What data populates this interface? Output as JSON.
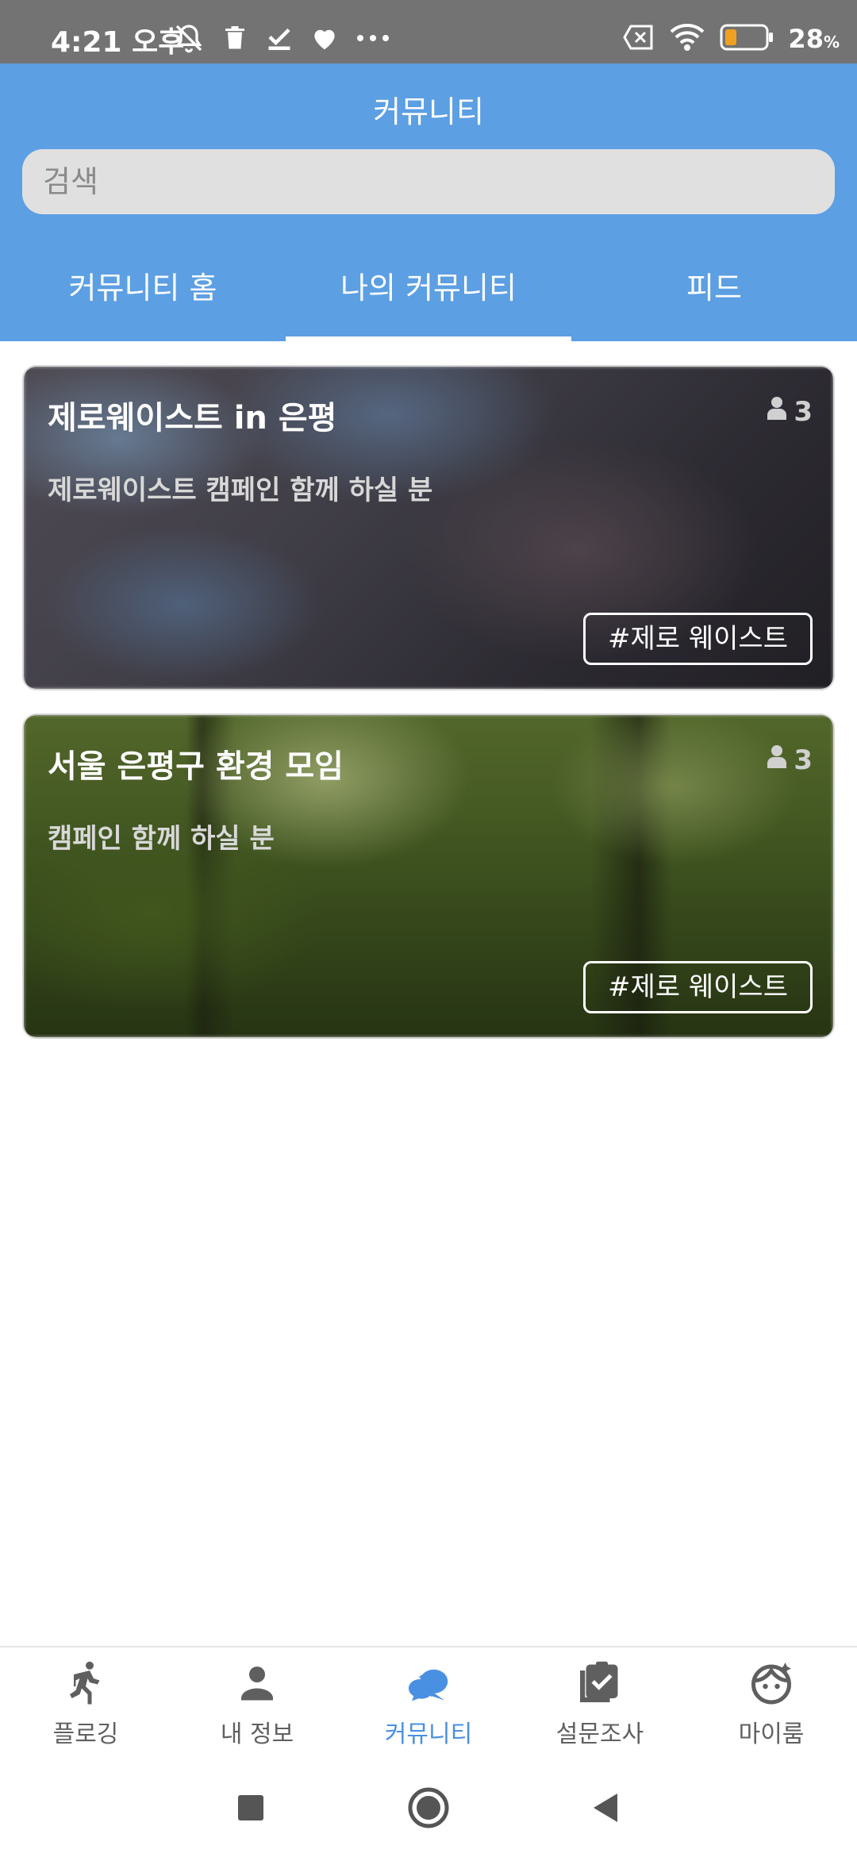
{
  "status_bar": {
    "time": "4:21 오후",
    "battery_percent": "28",
    "battery_unit": "%",
    "left_icons": [
      "silent-bell-off-icon",
      "trash-icon",
      "check-download-icon",
      "heart-icon",
      "more-dots-icon"
    ],
    "right_icons": [
      "no-sim-icon",
      "wifi-icon",
      "battery-icon"
    ]
  },
  "header": {
    "title": "커뮤니티",
    "search": {
      "placeholder": "검색",
      "value": ""
    },
    "tabs": [
      {
        "label": "커뮤니티 홈",
        "selected": false
      },
      {
        "label": "나의 커뮤니티",
        "selected": true
      },
      {
        "label": "피드",
        "selected": false
      }
    ]
  },
  "communities": [
    {
      "title": "제로웨이스트 in 은평",
      "members": "3",
      "description": "제로웨이스트 캠페인 함께 하실 분",
      "tag": "#제로 웨이스트",
      "background": "blurred cherry blossom photo"
    },
    {
      "title": "서울 은평구 환경 모임",
      "members": "3",
      "description": "캠페인 함께 하실 분",
      "tag": "#제로 웨이스트",
      "background": "blurred green forest photo"
    }
  ],
  "bottom_nav": {
    "items": [
      {
        "label": "플로깅",
        "icon": "running-person-icon",
        "active": false
      },
      {
        "label": "내 정보",
        "icon": "person-icon",
        "active": false
      },
      {
        "label": "커뮤니티",
        "icon": "chat-bubbles-icon",
        "active": true
      },
      {
        "label": "설문조사",
        "icon": "clipboard-check-icon",
        "active": false
      },
      {
        "label": "마이룸",
        "icon": "face-icon",
        "active": false
      }
    ]
  },
  "colors": {
    "header_blue": "#5c9fe3",
    "active_nav": "#4a90e2",
    "status_bar": "#737373",
    "battery_fill": "#f0a020"
  }
}
